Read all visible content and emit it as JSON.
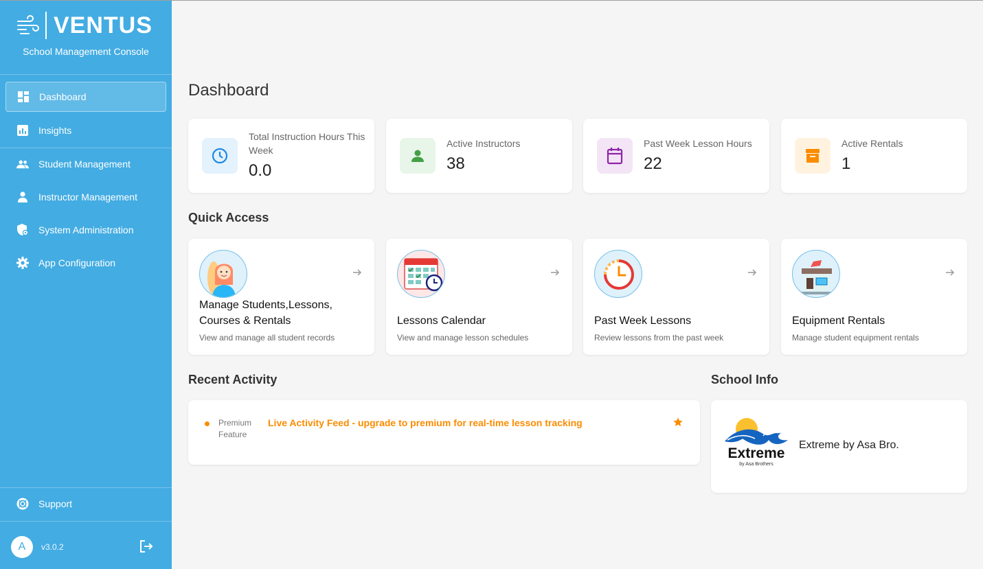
{
  "brand": {
    "name": "VENTUS",
    "subtitle": "School Management Console"
  },
  "nav": {
    "items": [
      {
        "label": "Dashboard",
        "icon": "dashboard-icon",
        "active": true
      },
      {
        "label": "Insights",
        "icon": "insights-icon"
      },
      {
        "label": "Student Management",
        "icon": "students-icon"
      },
      {
        "label": "Instructor Management",
        "icon": "instructor-icon"
      },
      {
        "label": "System Administration",
        "icon": "admin-shield-icon"
      },
      {
        "label": "App Configuration",
        "icon": "gear-icon"
      }
    ],
    "support": {
      "label": "Support",
      "icon": "lifebuoy-icon"
    }
  },
  "user": {
    "initial": "A",
    "version": "v3.0.2"
  },
  "page": {
    "title": "Dashboard"
  },
  "colors": {
    "sidebar": "#43ace2",
    "accent_orange": "#fb8c00"
  },
  "stats": [
    {
      "label": "Total Instruction Hours This Week",
      "value": "0.0",
      "icon": "clock-icon"
    },
    {
      "label": "Active Instructors",
      "value": "38",
      "icon": "person-icon"
    },
    {
      "label": "Past Week Lesson Hours",
      "value": "22",
      "icon": "calendar-icon"
    },
    {
      "label": "Active Rentals",
      "value": "1",
      "icon": "archive-box-icon"
    }
  ],
  "quick_access": {
    "title": "Quick Access",
    "cards": [
      {
        "title": "Manage Students,Lessons, Courses & Rentals",
        "desc": "View and manage all student records"
      },
      {
        "title": "Lessons Calendar",
        "desc": "View and manage lesson schedules"
      },
      {
        "title": "Past Week Lessons",
        "desc": "Review lessons from the past week"
      },
      {
        "title": "Equipment Rentals",
        "desc": "Manage student equipment rentals"
      }
    ]
  },
  "activity": {
    "title": "Recent Activity",
    "label": "Premium Feature",
    "text": "Live Activity Feed - upgrade to premium for real-time lesson tracking"
  },
  "school": {
    "title": "School Info",
    "name": "Extreme by Asa Bro.",
    "logo_text": "Extreme",
    "logo_subtext": "by Asa Brothers"
  }
}
